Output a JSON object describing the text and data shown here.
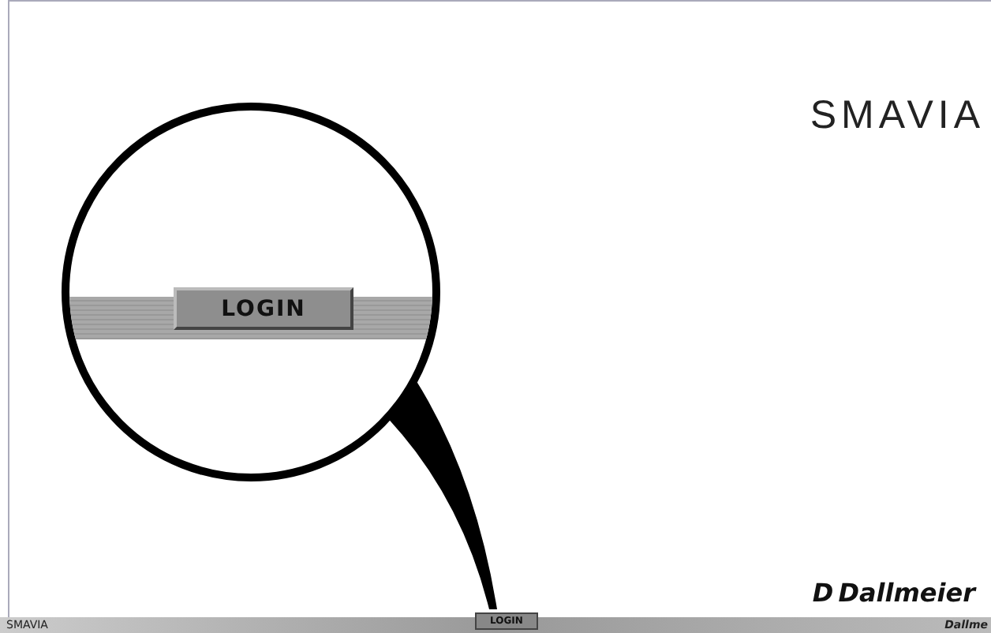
{
  "header": {
    "logo": "SMAVIA"
  },
  "magnifier": {
    "button": "LOGIN"
  },
  "footer_logo": {
    "mark": "D",
    "name": "Dallmeier"
  },
  "bottom_bar": {
    "left_logo": "SMAVIA",
    "button": "LOGIN",
    "right_logo": "Dallme"
  }
}
